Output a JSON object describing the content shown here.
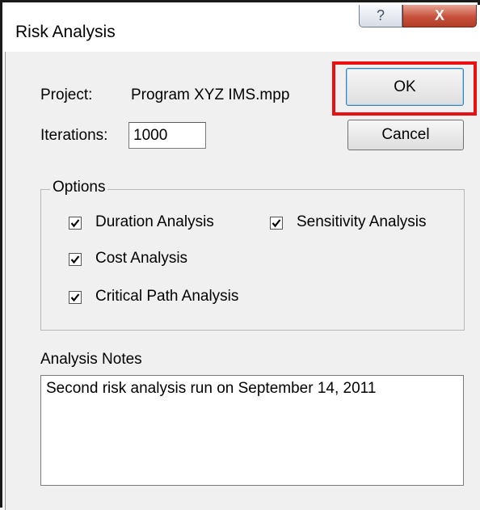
{
  "window": {
    "title": "Risk Analysis",
    "help_label": "?",
    "close_label": "X"
  },
  "project": {
    "label": "Project:",
    "value": "Program XYZ IMS.mpp"
  },
  "iterations": {
    "label": "Iterations:",
    "value": "1000"
  },
  "buttons": {
    "ok": "OK",
    "cancel": "Cancel"
  },
  "options": {
    "legend": "Options",
    "duration": {
      "label": "Duration Analysis",
      "checked": true
    },
    "sensitivity": {
      "label": "Sensitivity Analysis",
      "checked": true
    },
    "cost": {
      "label": "Cost Analysis",
      "checked": true
    },
    "critical_path": {
      "label": "Critical Path Analysis",
      "checked": true
    }
  },
  "notes": {
    "label": "Analysis Notes",
    "value": "Second risk analysis run on September 14, 2011"
  },
  "colors": {
    "highlight": "#e81010",
    "dialog_bg": "#f0f0f0",
    "close_button": "#c8513c"
  }
}
